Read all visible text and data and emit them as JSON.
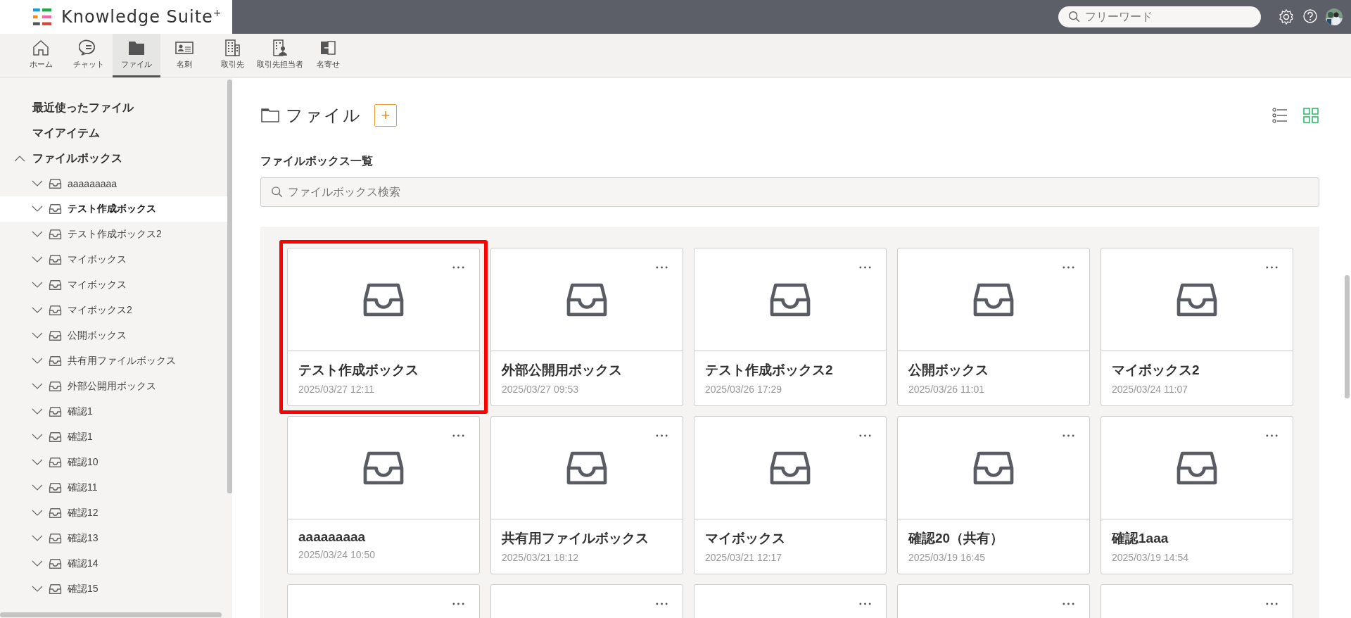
{
  "header": {
    "logo_text": "Knowledge Suite",
    "logo_sup": "+",
    "search": {
      "placeholder": "フリーワード"
    }
  },
  "nav": [
    {
      "kind": "home",
      "label": "ホーム",
      "selected": false
    },
    {
      "kind": "chat",
      "label": "チャット",
      "selected": false
    },
    {
      "kind": "folder",
      "label": "ファイル",
      "selected": true
    },
    {
      "kind": "card",
      "label": "名刺",
      "selected": false
    },
    {
      "kind": "building",
      "label": "取引先",
      "selected": false
    },
    {
      "kind": "contact",
      "label": "取引先担当者",
      "selected": false
    },
    {
      "kind": "merge",
      "label": "名寄せ",
      "selected": false
    }
  ],
  "sidebar": {
    "items": [
      {
        "label": "最近使ったファイル"
      },
      {
        "label": "マイアイテム"
      },
      {
        "label": "ファイルボックス",
        "expanded": true,
        "children": [
          {
            "label": "aaaaaaaaa",
            "expanded": false,
            "selected": false
          },
          {
            "label": "テスト作成ボックス",
            "expanded": false,
            "selected": true
          },
          {
            "label": "テスト作成ボックス2",
            "expanded": false,
            "selected": false
          },
          {
            "label": "マイボックス",
            "expanded": false,
            "selected": false
          },
          {
            "label": "マイボックス",
            "expanded": false,
            "selected": false
          },
          {
            "label": "マイボックス2",
            "expanded": false,
            "selected": false
          },
          {
            "label": "公開ボックス",
            "expanded": false,
            "selected": false
          },
          {
            "label": "共有用ファイルボックス",
            "expanded": false,
            "selected": false
          },
          {
            "label": "外部公開用ボックス",
            "expanded": false,
            "selected": false
          },
          {
            "label": "確認1",
            "expanded": false,
            "selected": false
          },
          {
            "label": "確認1",
            "expanded": false,
            "selected": false
          },
          {
            "label": "確認10",
            "expanded": false,
            "selected": false
          },
          {
            "label": "確認11",
            "expanded": false,
            "selected": false
          },
          {
            "label": "確認12",
            "expanded": false,
            "selected": false
          },
          {
            "label": "確認13",
            "expanded": false,
            "selected": false
          },
          {
            "label": "確認14",
            "expanded": false,
            "selected": false
          },
          {
            "label": "確認15",
            "expanded": false,
            "selected": false
          }
        ]
      }
    ]
  },
  "main": {
    "title": "ファイル",
    "add_button": "+",
    "view_modes": [
      {
        "kind": "list",
        "selected": false
      },
      {
        "kind": "grid",
        "selected": true
      }
    ],
    "section_title": "ファイルボックス一覧",
    "search": {
      "placeholder": "ファイルボックス検索"
    },
    "cards": [
      {
        "title": "テスト作成ボックス",
        "date": "2025/03/27 12:11",
        "highlighted": true,
        "menu": true
      },
      {
        "title": "外部公開用ボックス",
        "date": "2025/03/27 09:53",
        "highlighted": false,
        "menu": true
      },
      {
        "title": "テスト作成ボックス2",
        "date": "2025/03/26 17:29",
        "highlighted": false,
        "menu": true
      },
      {
        "title": "公開ボックス",
        "date": "2025/03/26 11:01",
        "highlighted": false,
        "menu": true
      },
      {
        "title": "マイボックス2",
        "date": "2025/03/24 11:07",
        "highlighted": false,
        "menu": true
      },
      {
        "title": "aaaaaaaaa",
        "date": "2025/03/24 10:50",
        "highlighted": false,
        "menu": true
      },
      {
        "title": "共有用ファイルボックス",
        "date": "2025/03/21 18:12",
        "highlighted": false,
        "menu": true
      },
      {
        "title": "マイボックス",
        "date": "2025/03/21 12:17",
        "highlighted": false,
        "menu": true
      },
      {
        "title": "確認20（共有）",
        "date": "2025/03/19 16:45",
        "highlighted": false,
        "menu": true
      },
      {
        "title": "確認1aaa",
        "date": "2025/03/19 14:54",
        "highlighted": false,
        "menu": true
      },
      {
        "highlighted": false,
        "menu": true
      },
      {
        "highlighted": false,
        "menu": true
      },
      {
        "highlighted": false,
        "menu": true
      },
      {
        "highlighted": false,
        "menu": true
      },
      {
        "highlighted": false,
        "menu": true
      }
    ]
  }
}
